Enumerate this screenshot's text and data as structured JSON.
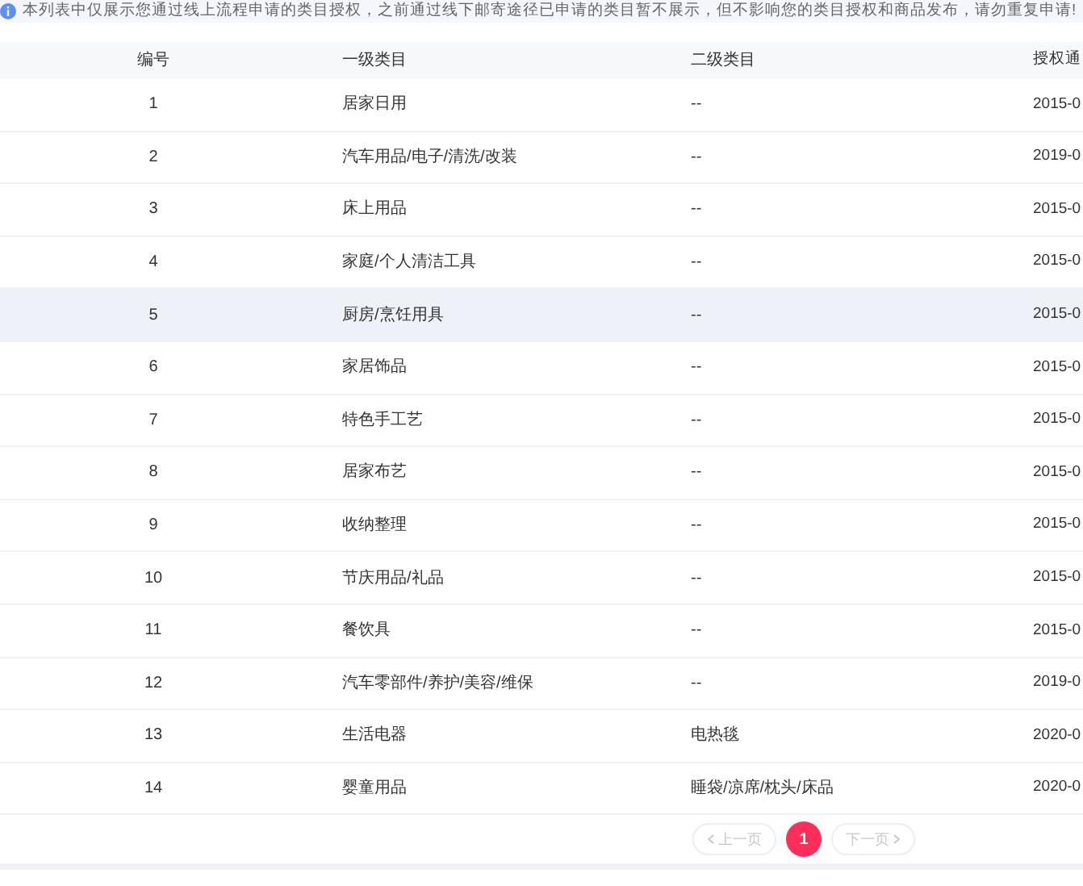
{
  "notice": {
    "text": "本列表中仅展示您通过线上流程申请的类目授权，之前通过线下邮寄途径已申请的类目暂不展示，但不影响您的类目授权和商品发布，请勿重复申请!"
  },
  "table": {
    "columns": [
      "编号",
      "一级类目",
      "二级类目",
      "授权通"
    ],
    "rows": [
      {
        "no": "1",
        "level1": "居家日用",
        "level2": "--",
        "date": "2015-0",
        "selected": false
      },
      {
        "no": "2",
        "level1": "汽车用品/电子/清洗/改装",
        "level2": "--",
        "date": "2019-0",
        "selected": false
      },
      {
        "no": "3",
        "level1": "床上用品",
        "level2": "--",
        "date": "2015-0",
        "selected": false
      },
      {
        "no": "4",
        "level1": "家庭/个人清洁工具",
        "level2": "--",
        "date": "2015-0",
        "selected": false
      },
      {
        "no": "5",
        "level1": "厨房/烹饪用具",
        "level2": "--",
        "date": "2015-0",
        "selected": true
      },
      {
        "no": "6",
        "level1": "家居饰品",
        "level2": "--",
        "date": "2015-0",
        "selected": false
      },
      {
        "no": "7",
        "level1": "特色手工艺",
        "level2": "--",
        "date": "2015-0",
        "selected": false
      },
      {
        "no": "8",
        "level1": "居家布艺",
        "level2": "--",
        "date": "2015-0",
        "selected": false
      },
      {
        "no": "9",
        "level1": "收纳整理",
        "level2": "--",
        "date": "2015-0",
        "selected": false
      },
      {
        "no": "10",
        "level1": "节庆用品/礼品",
        "level2": "--",
        "date": "2015-0",
        "selected": false
      },
      {
        "no": "11",
        "level1": "餐饮具",
        "level2": "--",
        "date": "2015-0",
        "selected": false
      },
      {
        "no": "12",
        "level1": "汽车零部件/养护/美容/维保",
        "level2": "--",
        "date": "2019-0",
        "selected": false
      },
      {
        "no": "13",
        "level1": "生活电器",
        "level2": "电热毯",
        "date": "2020-0",
        "selected": false
      },
      {
        "no": "14",
        "level1": "婴童用品",
        "level2": "睡袋/凉席/枕头/床品",
        "date": "2020-0",
        "selected": false
      }
    ]
  },
  "pagination": {
    "prev": {
      "label": "上一页",
      "disabled": true
    },
    "pages": [
      {
        "label": "1",
        "selected": true
      }
    ],
    "next": {
      "label": "下一页",
      "disabled": true
    }
  }
}
